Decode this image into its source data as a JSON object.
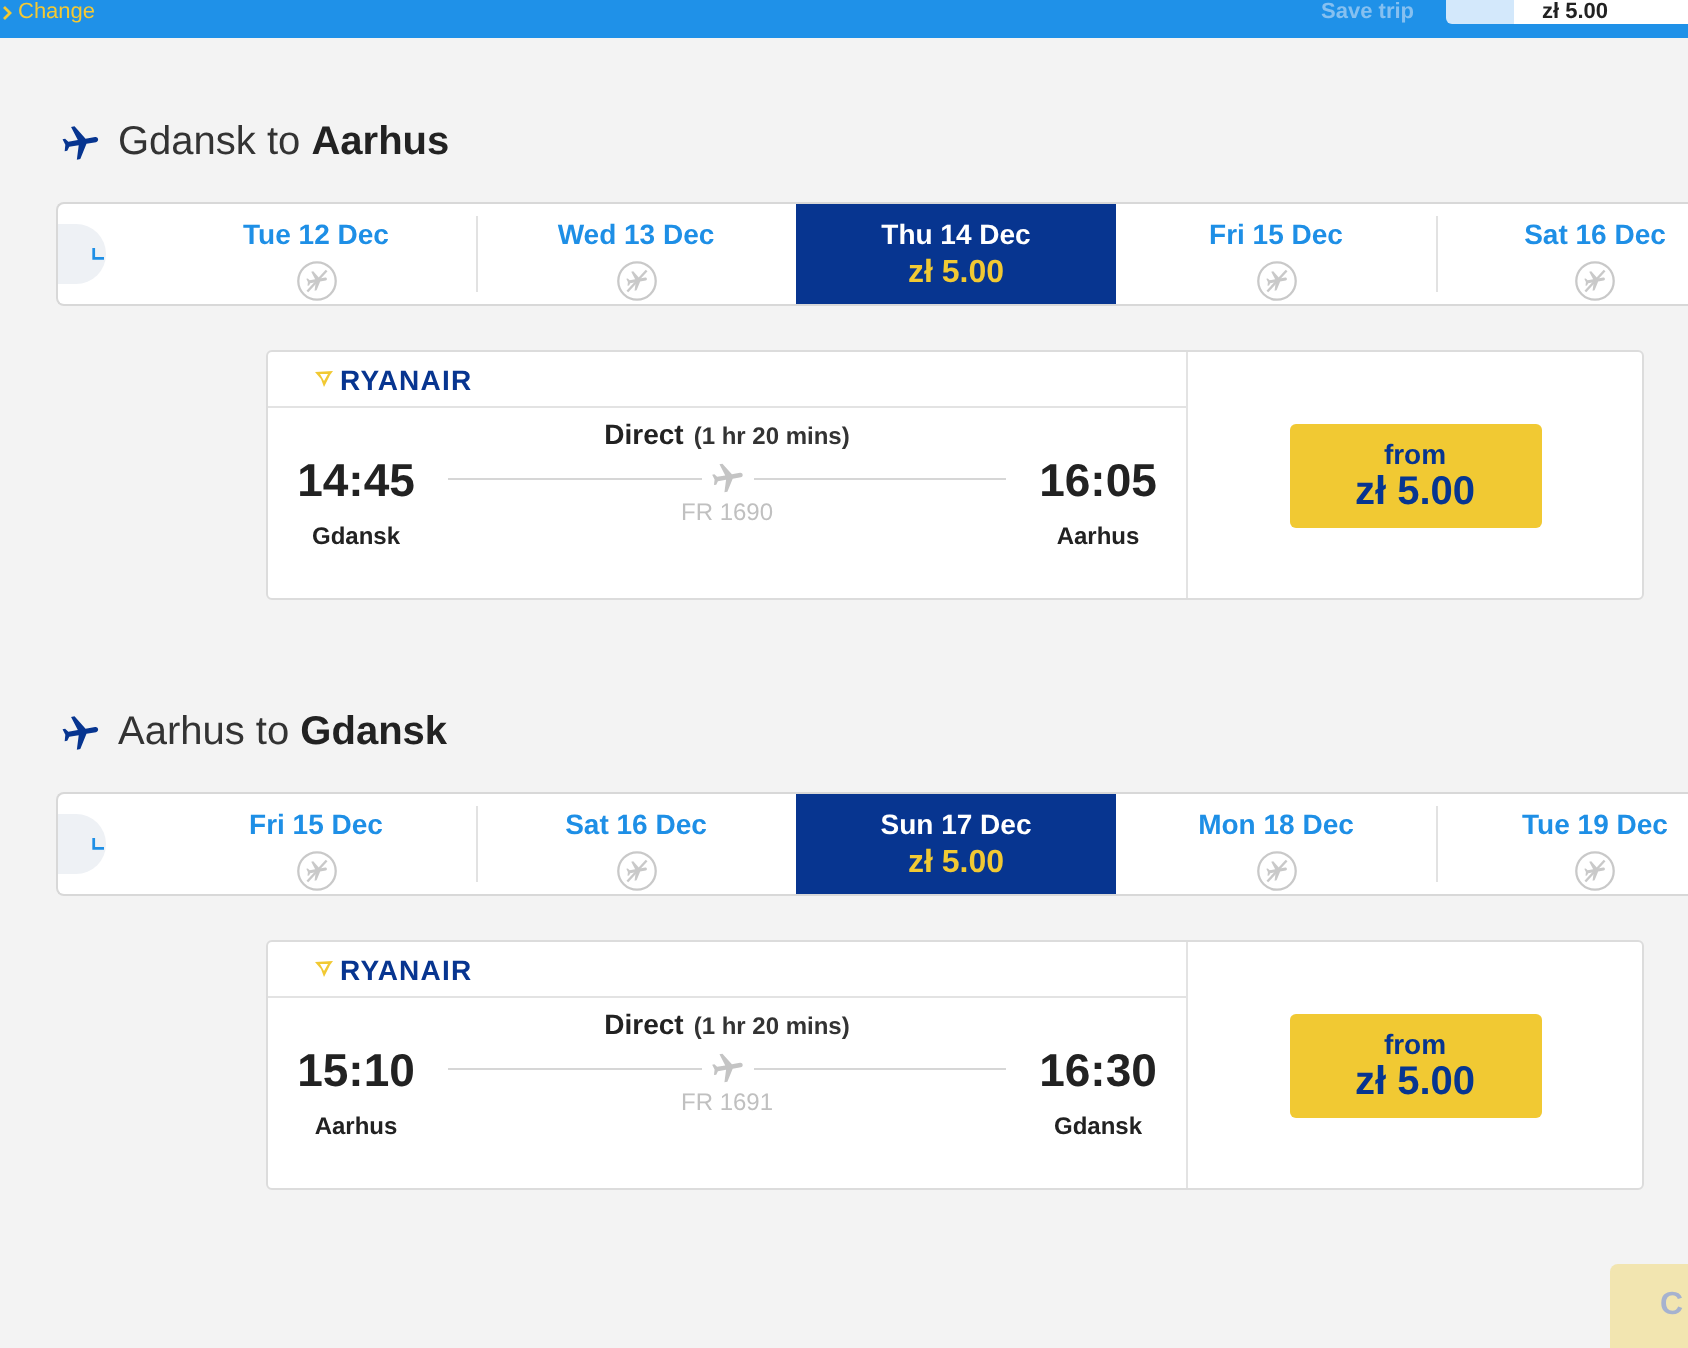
{
  "header": {
    "change_link": "Change",
    "save_trip": {
      "label": "Save trip",
      "disabled": true
    },
    "total_price": "zł 5.00"
  },
  "journeys": [
    {
      "title": "Gdansk to **Aarhus**",
      "dates": [
        {
          "label": "Tue 12 Dec",
          "kind": "no_flights",
          "selected": false
        },
        {
          "label": "Wed 13 Dec",
          "kind": "no_flights",
          "selected": false
        },
        {
          "label": "Thu 14 Dec",
          "kind": "fare",
          "price": "zł 5.00",
          "selected": true
        },
        {
          "label": "Fri 15 Dec",
          "kind": "no_flights",
          "selected": false
        },
        {
          "label": "Sat 16 Dec",
          "kind": "no_flights",
          "selected": false
        }
      ],
      "flight": {
        "airline": "RYANAIR",
        "stops": "Direct",
        "duration": "(1 hr 20 mins)",
        "depart_time": "14:45",
        "depart_city": "Gdansk",
        "arrive_time": "16:05",
        "arrive_city": "Aarhus",
        "flight_number": "FR 1690",
        "price_label": "from",
        "price": "zł 5.00"
      }
    },
    {
      "title": "Aarhus to **Gdansk**",
      "dates": [
        {
          "label": "Fri 15 Dec",
          "kind": "no_flights",
          "selected": false
        },
        {
          "label": "Sat 16 Dec",
          "kind": "no_flights",
          "selected": false
        },
        {
          "label": "Sun 17 Dec",
          "kind": "fare",
          "price": "zł 5.00",
          "selected": true
        },
        {
          "label": "Mon 18 Dec",
          "kind": "no_flights",
          "selected": false
        },
        {
          "label": "Tue 19 Dec",
          "kind": "no_flights",
          "selected": false
        }
      ],
      "flight": {
        "airline": "RYANAIR",
        "stops": "Direct",
        "duration": "(1 hr 20 mins)",
        "depart_time": "15:10",
        "depart_city": "Aarhus",
        "arrive_time": "16:30",
        "arrive_city": "Gdansk",
        "flight_number": "FR 1691",
        "price_label": "from",
        "price": "zł 5.00"
      }
    }
  ],
  "continue_button": {
    "label": "C",
    "disabled": true
  }
}
